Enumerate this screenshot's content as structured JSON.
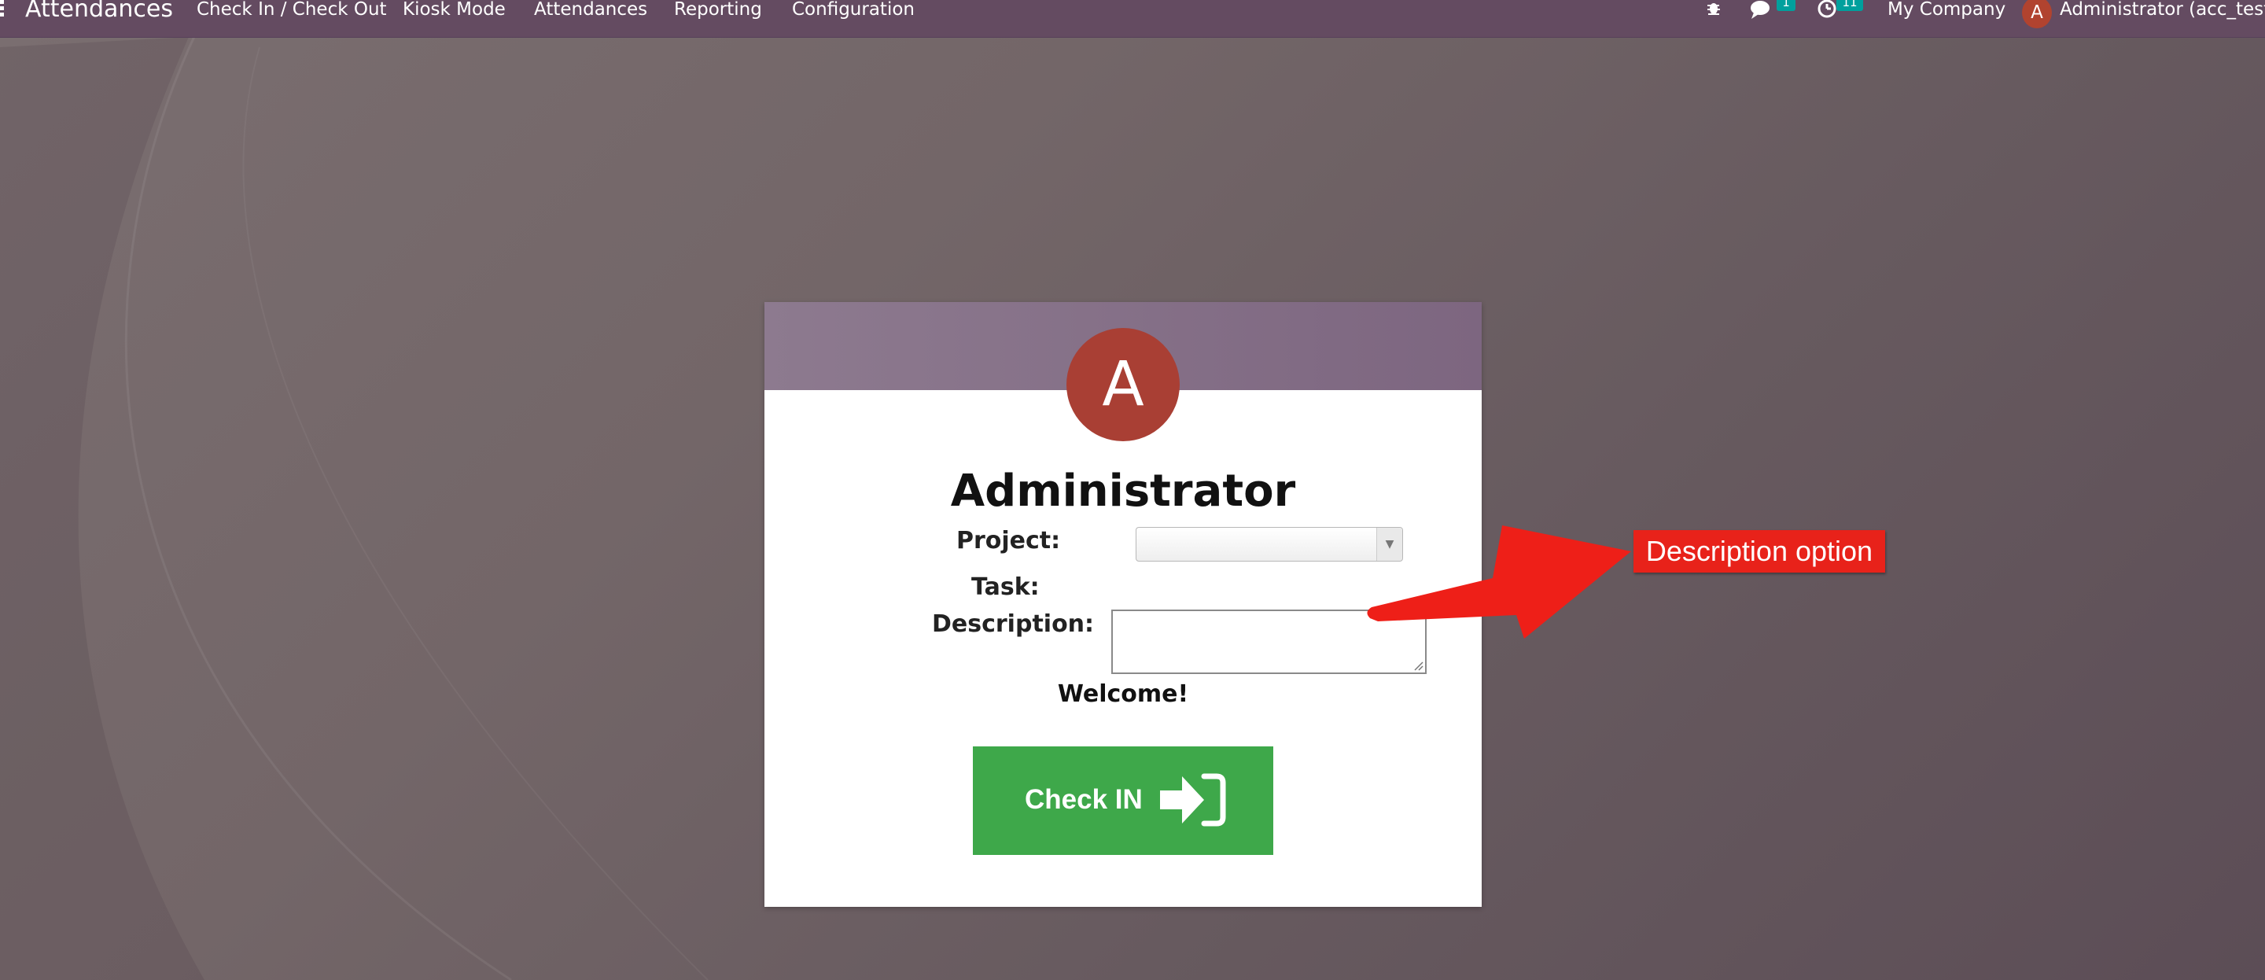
{
  "navbar": {
    "brand": "Attendances",
    "menu": [
      "Check In / Check Out",
      "Kiosk Mode",
      "Attendances",
      "Reporting",
      "Configuration"
    ],
    "icons": [
      "bug-icon",
      "chat-icon",
      "clock-icon"
    ],
    "messages_badge": "1",
    "activities_badge": "11",
    "company": "My Company",
    "user_initial": "A",
    "user_name": "Administrator (acc_test)"
  },
  "card": {
    "avatar_initial": "A",
    "employee_name": "Administrator",
    "project_label": "Project:",
    "project_value": "",
    "task_label": "Task:",
    "description_label": "Description:",
    "description_value": "",
    "welcome": "Welcome!",
    "check_button": "Check IN",
    "check_icon": "sign-in-icon"
  },
  "annotation": {
    "label": "Description option",
    "color": "#e8221a"
  },
  "colors": {
    "navbar": "#644b61",
    "card_header": "#8d7a8f",
    "avatar": "#a93f34",
    "check_button": "#3ea84a"
  }
}
